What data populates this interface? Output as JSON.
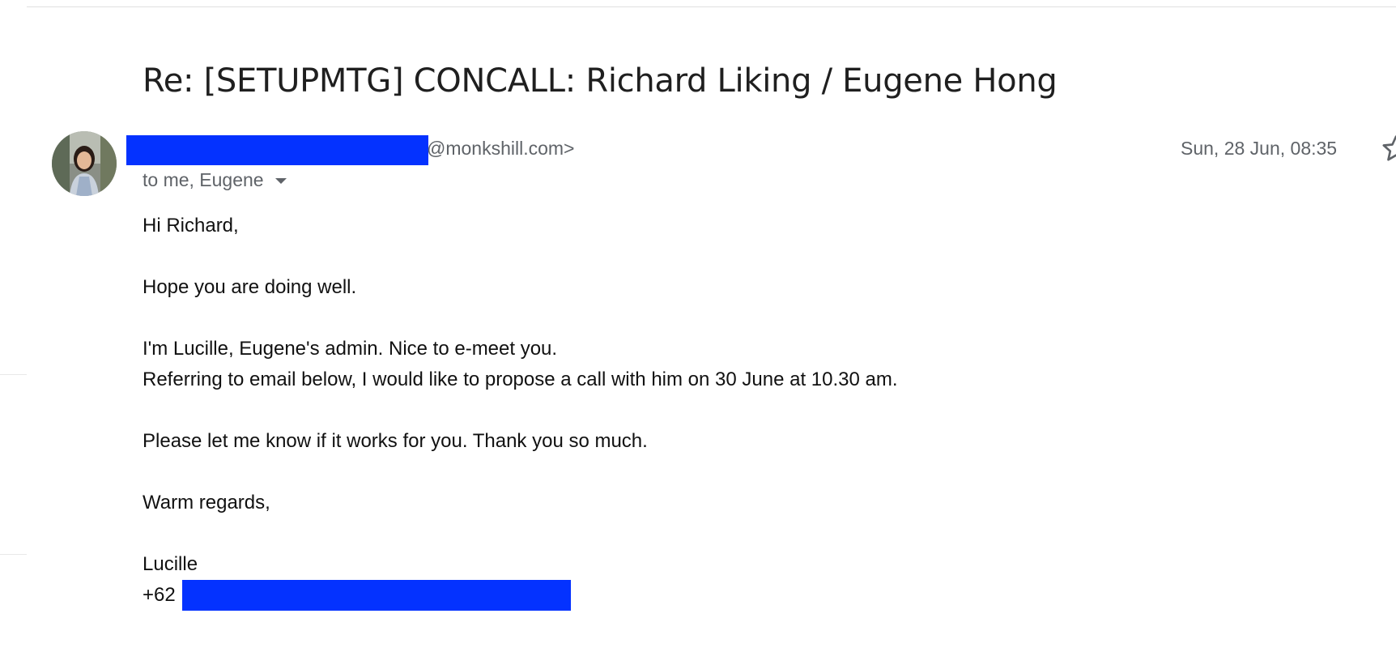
{
  "email": {
    "subject": "Re: [SETUPMTG] CONCALL: Richard Liking / Eugene Hong",
    "sender_domain": "@monkshill.com>",
    "recipients": "to me, Eugene",
    "date": "Sun, 28 Jun, 08:35",
    "body": {
      "greeting": "Hi Richard,",
      "line1": "Hope you are doing well.",
      "line2": "I'm Lucille, Eugene's admin. Nice to e-meet you.",
      "line3": "Referring to email below, I would like to propose a call with him on 30 June at 10.30 am.",
      "line4": "Please let me know if it works for you. Thank you so much.",
      "closing": "Warm regards,",
      "signature_name": "Lucille",
      "phone_prefix": "+62"
    }
  },
  "icons": {
    "recipients_toggle": "caret-down-icon",
    "star": "star-outline-icon"
  },
  "colors": {
    "redaction": "#0432ff",
    "meta_text": "#5f6368",
    "subject_text": "#1f1f1f"
  }
}
